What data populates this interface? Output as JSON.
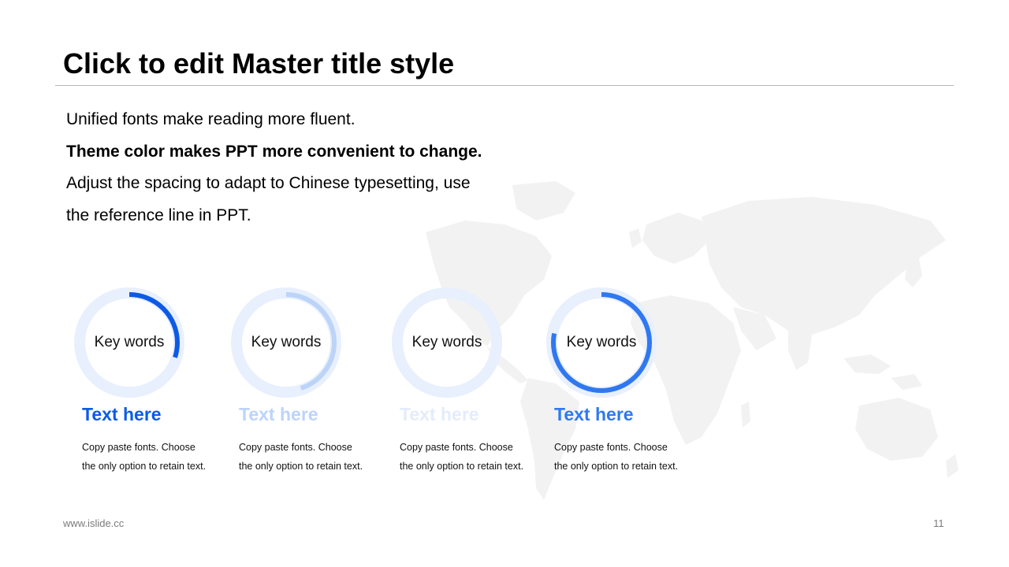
{
  "slide": {
    "title": "Click to edit Master title style",
    "body_lines": [
      "Unified fonts make reading more fluent.",
      "Theme color makes PPT more convenient to change.",
      "Adjust the spacing to adapt to Chinese typesetting, use",
      "the reference line in PPT."
    ]
  },
  "colors": {
    "ring_track": "#e8effd",
    "item1": "#0d5be5",
    "item2": "#bcd4f8",
    "item3": "#e4ecfb",
    "item4": "#2f78f0",
    "map": "#f2f2f2"
  },
  "items": [
    {
      "ring_label": "Key words",
      "heading": "Text here",
      "desc_line1": "Copy paste fonts. Choose",
      "desc_line2": "the only option to retain text.",
      "progress": 0.3
    },
    {
      "ring_label": "Key words",
      "heading": "Text here",
      "desc_line1": "Copy paste fonts. Choose",
      "desc_line2": "the only option to retain text.",
      "progress": 0.45
    },
    {
      "ring_label": "Key words",
      "heading": "Text here",
      "desc_line1": "Copy paste fonts. Choose",
      "desc_line2": "the only option to retain text.",
      "progress": 0.0
    },
    {
      "ring_label": "Key words",
      "heading": "Text here",
      "desc_line1": "Copy paste fonts. Choose",
      "desc_line2": "the only option to retain text.",
      "progress": 0.78
    }
  ],
  "footer": {
    "url": "www.islide.cc",
    "page_number": "11"
  }
}
